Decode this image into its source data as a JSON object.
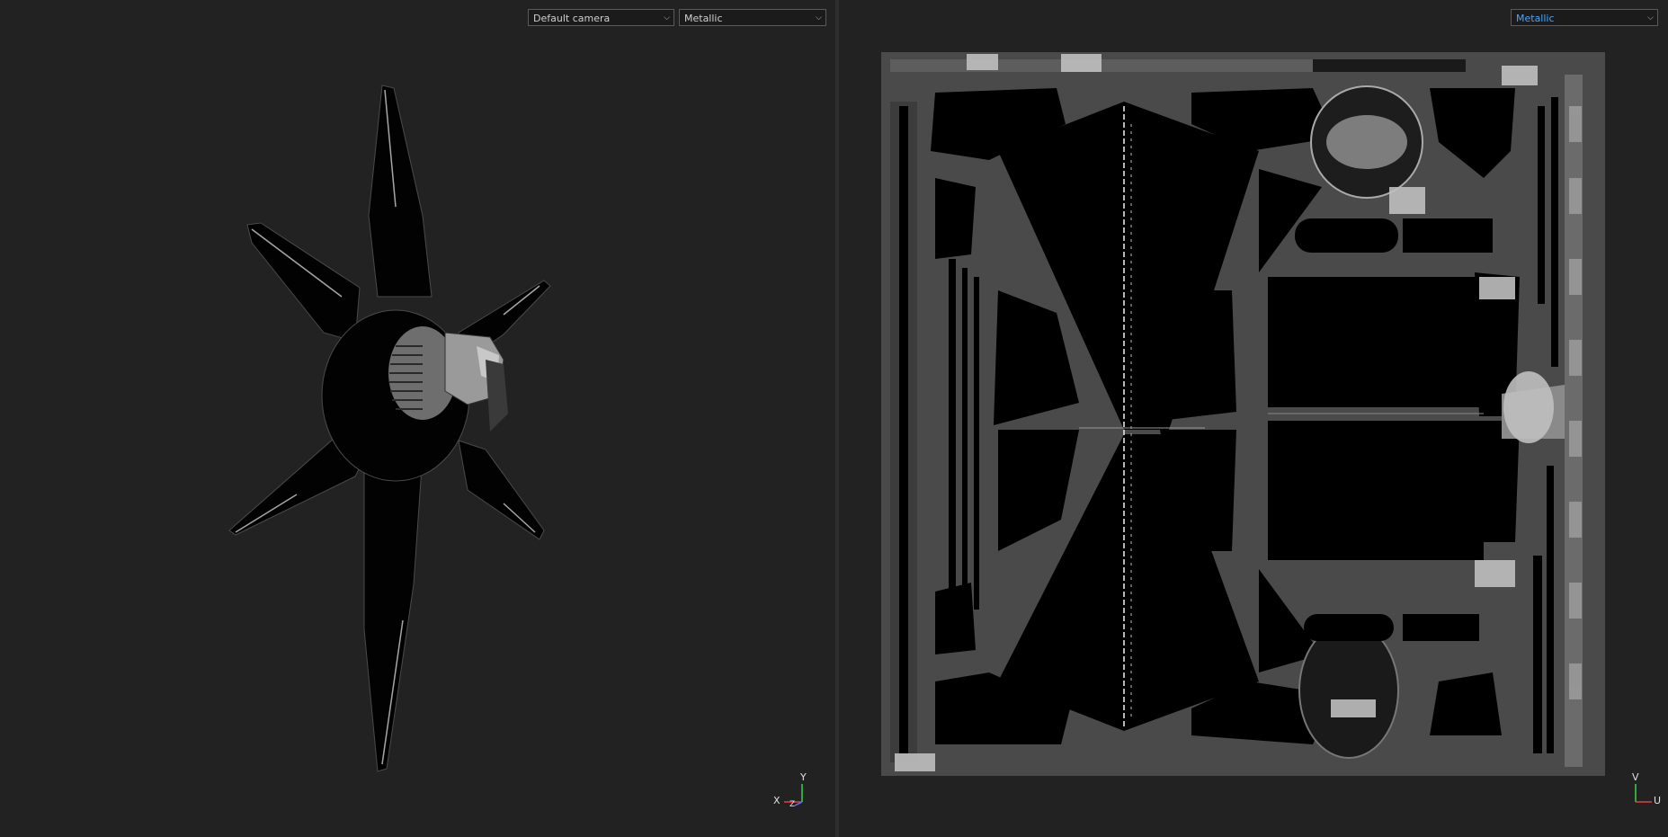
{
  "viewport_3d": {
    "camera_select": {
      "value": "Default camera"
    },
    "channel_select": {
      "value": "Metallic"
    },
    "axis_gizmo": {
      "x": "X",
      "y": "Y",
      "z": "Z"
    }
  },
  "viewport_2d": {
    "channel_select": {
      "value": "Metallic"
    },
    "axis_gizmo": {
      "v": "V",
      "u": "U"
    }
  },
  "colors": {
    "background": "#222222",
    "accent": "#4aa3ff",
    "x_axis": "#e04040",
    "y_axis": "#3fd24a",
    "z_axis": "#4a7bff"
  }
}
